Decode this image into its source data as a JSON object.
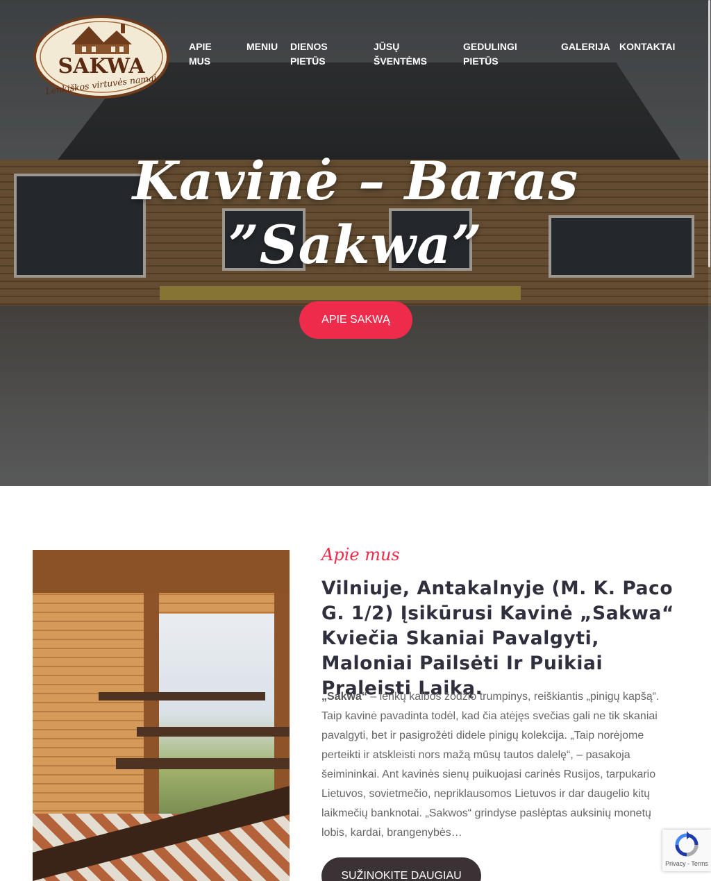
{
  "header": {
    "logo": {
      "name": "SAKWA",
      "tagline": "Lenkiškos virtuvės namai"
    },
    "nav": [
      {
        "label": "APIE MUS"
      },
      {
        "label": "MENIU"
      },
      {
        "label": "DIENOS PIETŪS"
      },
      {
        "label": "JŪSŲ ŠVENTĖMS"
      },
      {
        "label": "GEDULINGI PIETŪS"
      },
      {
        "label": "GALERIJA"
      },
      {
        "label": "KONTAKTAI"
      }
    ]
  },
  "hero": {
    "title_line1": "Kavinė – Baras",
    "title_line2": "”Sakwa”",
    "button_label": "APIE SAKWĄ"
  },
  "about": {
    "eyebrow": "Apie mus",
    "heading": "Vilniuje, Antakalnyje (M. K. Paco G. 1/2) Įsikūrusi Kavinė „Sakwa“ Kviečia Skaniai Pavalgyti, Maloniai Pailsėti Ir Puikiai Praleisti Laiką.",
    "text_bold": "„Sakwa“",
    "text_body": " – lenkų kalbos žodžio trumpinys, reiškiantis „pinigų kapšą“. Taip kavinė pavadinta todėl, kad čia atėjęs svečias gali ne tik skaniai pavalgyti, bet ir pasigrožėti didele pinigų kolekcija. „Taip norėjome perteikti ir atskleisti nors mažą mūsų tautos dalelę“, – pasakoja šeimininkai. Ant kavinės sienų puikuojasi carinės Rusijos, tarpukario Lietuvos, sovietmečio, nepriklausomos Lietuvos ir dar daugelio kitų laikmečių banknotai. „Sakwos“ grindyse paslėptas auksinių monetų lobis, kardai, brangenybės…",
    "button_label": "SUŽINOKITE DAUGIAU"
  },
  "recaptcha": {
    "terms": "Privacy - Terms"
  },
  "colors": {
    "accent": "#ee2b4a",
    "dark_button": "#3b3236",
    "heading": "#2f2f3d",
    "body_text": "#666666"
  }
}
